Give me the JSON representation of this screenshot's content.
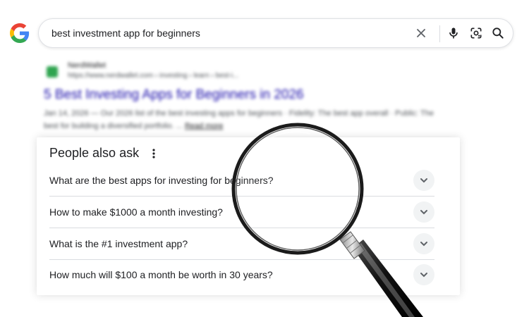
{
  "search": {
    "query": "best investment app for beginners"
  },
  "result": {
    "site_name": "NerdWallet",
    "url": "https://www.nerdwallet.com › investing › learn › best-i...",
    "title": "5 Best Investing Apps for Beginners in 2026",
    "snippet": "Jan 14, 2026 — Our 2026 list of the best investing apps for beginners · Fidelity: The best app overall · Public: The best for building a diversified portfolio. ...",
    "read_more": "Read more"
  },
  "paa": {
    "title": "People also ask",
    "questions": [
      "What are the best apps for investing for beginners?",
      "How to make $1000 a month investing?",
      "What is the #1 investment app?",
      "How much will $100 a month be worth in 30 years?"
    ]
  },
  "colors": {
    "link": "#1a0dab",
    "text": "#202124",
    "google_blue": "#4285F4",
    "google_red": "#EA4335",
    "google_yellow": "#FBBC05",
    "google_green": "#34A853"
  },
  "icons": [
    "google-logo",
    "clear-icon",
    "mic-icon",
    "lens-icon",
    "search-icon",
    "more-vert-icon",
    "chevron-down-icon",
    "magnifying-glass"
  ]
}
